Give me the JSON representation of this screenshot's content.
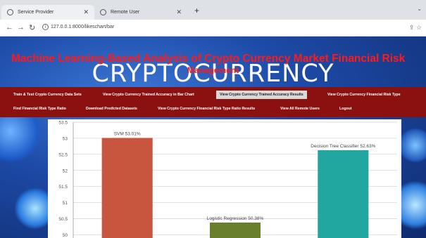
{
  "browser": {
    "tabs": [
      {
        "label": "Service Provider"
      },
      {
        "label": "Remote User"
      }
    ],
    "new_tab": "+",
    "url": "127.0.0.1:8000/likeschart/bar"
  },
  "site": {
    "title": "Machine Learning-Based Analysis of Crypto Currency Market Financial Risk",
    "title_line2": "Management",
    "banner_word": "CRYPTOCURRENCY"
  },
  "menu": {
    "row1": [
      "Train & Test Crypto Currency Data Sets",
      "View Crypto Currency Trained Accuracy in Bar Chart",
      "View Crypto Currency Trained Accuracy Results",
      "View Crypto Currency Financial Risk Type"
    ],
    "row2": [
      "Find Financial Risk Type Ratio",
      "Download Predicted Datasets",
      "View Crypto Currency Financial Risk Type Ratio Results",
      "View All Remote Users",
      "Logout"
    ],
    "active_index": 2
  },
  "chart_data": {
    "type": "bar",
    "categories": [
      "SVM",
      "Logistic Regression",
      "Decision Tree Classifier"
    ],
    "values": [
      53.01,
      50.38,
      52.63
    ],
    "data_labels": [
      "SVM 53.01%",
      "Logistic Regression 50.38%",
      "Decision Tree Classifier 52.63%"
    ],
    "colors": [
      "#c8553d",
      "#6a7f2e",
      "#22a6a0"
    ],
    "ytick_labels": [
      "50",
      "50.5",
      "51",
      "51.5",
      "52",
      "52.5",
      "53",
      "53.5"
    ],
    "ylim": [
      49.9,
      53.5
    ],
    "grid": true
  }
}
